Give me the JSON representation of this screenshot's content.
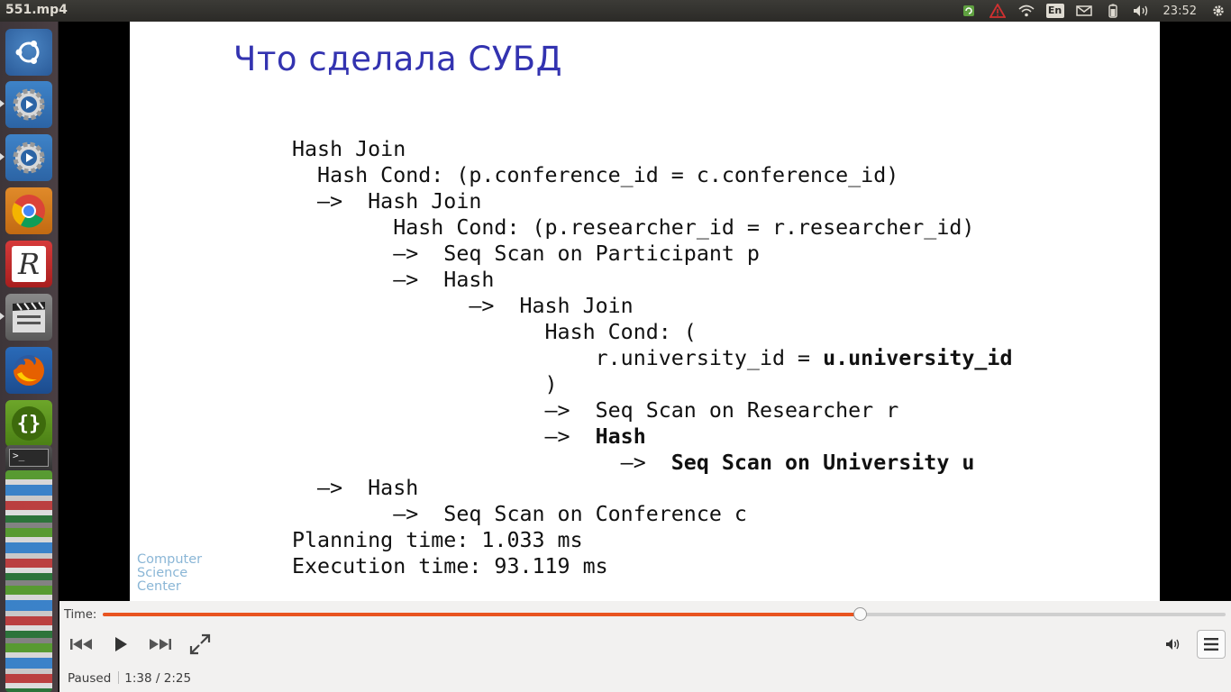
{
  "window": {
    "title": "551.mp4"
  },
  "tray": {
    "clock": "23:52",
    "keyboard_layout": "En"
  },
  "launcher": {
    "items": [
      {
        "name": "ubuntu-dash-icon"
      },
      {
        "name": "system-settings-icon-1"
      },
      {
        "name": "system-settings-icon-2"
      },
      {
        "name": "chrome-icon"
      },
      {
        "name": "rstudio-icon",
        "label": "R"
      },
      {
        "name": "video-editor-icon"
      },
      {
        "name": "firefox-icon"
      },
      {
        "name": "code-editor-icon",
        "label": "{}"
      },
      {
        "name": "terminal-icon"
      }
    ]
  },
  "slide": {
    "title": "Что сделала СУБД",
    "logo": [
      "Computer",
      "Science",
      "Center"
    ],
    "plan_lines": [
      "Hash Join",
      "  Hash Cond: (p.conference_id = c.conference_id)",
      "  —>  Hash Join",
      "        Hash Cond: (p.researcher_id = r.researcher_id)",
      "        —>  Seq Scan on Participant p",
      "        —>  Hash",
      "              —>  Hash Join",
      "                    Hash Cond: (",
      "                        r.university_id = ",
      "                    )",
      "                    —>  Seq Scan on Researcher r",
      "                    —>  ",
      "                          —>  ",
      "  —>  Hash",
      "        —>  Seq Scan on Conference c",
      "Planning time: 1.033 ms",
      "Execution time: 93.119 ms"
    ],
    "bold_fragments": {
      "university_ref": "u.university_id",
      "hash": "Hash",
      "seq_scan_university": "Seq Scan on University u"
    }
  },
  "player": {
    "time_label": "Time:",
    "progress_fraction": 0.674,
    "status": "Paused",
    "position": "1:38 / 2:25",
    "accent_color": "#e95420"
  }
}
